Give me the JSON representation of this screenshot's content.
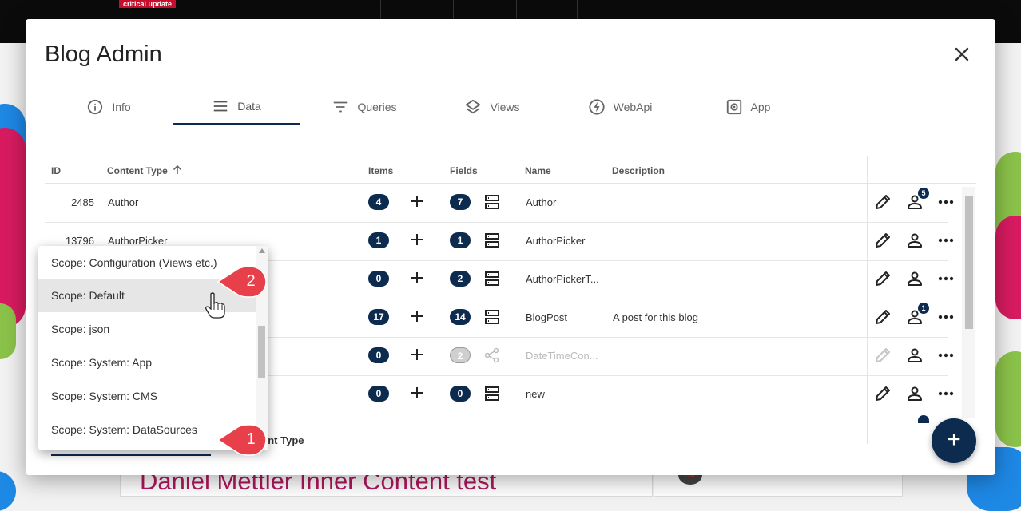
{
  "background": {
    "badge": "critical update",
    "content_title": "Daniel Mettler Inner Content test"
  },
  "dialog": {
    "title": "Blog Admin",
    "close_icon": "close-icon"
  },
  "tabs": [
    {
      "label": "Info",
      "icon": "info-icon"
    },
    {
      "label": "Data",
      "icon": "menu-lines-icon",
      "active": true
    },
    {
      "label": "Queries",
      "icon": "filter-icon"
    },
    {
      "label": "Views",
      "icon": "layers-icon"
    },
    {
      "label": "WebApi",
      "icon": "bolt-icon"
    },
    {
      "label": "App",
      "icon": "settings-box-icon"
    }
  ],
  "table": {
    "headers": {
      "id": "ID",
      "content_type": "Content Type",
      "items": "Items",
      "fields": "Fields",
      "name": "Name",
      "description": "Description"
    },
    "sort_icon": "arrow-up-icon",
    "rows": [
      {
        "id": "2485",
        "content_type": "Author",
        "items": "4",
        "fields": "7",
        "name": "Author",
        "description": "",
        "perm_badge": "5"
      },
      {
        "id": "13796",
        "content_type": "AuthorPicker",
        "items": "1",
        "fields": "1",
        "name": "AuthorPicker",
        "description": ""
      },
      {
        "id": "",
        "content_type": "",
        "items": "0",
        "fields": "2",
        "name": "AuthorPickerT...",
        "description": ""
      },
      {
        "id": "",
        "content_type": "",
        "items": "17",
        "fields": "14",
        "name": "BlogPost",
        "description": "A post for this blog",
        "perm_badge": "1"
      },
      {
        "id": "",
        "content_type": "",
        "items": "0",
        "fields": "2",
        "name": "DateTimeCon...",
        "description": "",
        "disabled": true
      },
      {
        "id": "",
        "content_type": "",
        "items": "0",
        "fields": "0",
        "name": "new",
        "description": ""
      }
    ]
  },
  "scope_dropdown": {
    "options": [
      "Scope: Configuration (Views etc.)",
      "Scope: Default",
      "Scope: json",
      "Scope: System: App",
      "Scope: System: CMS",
      "Scope: System: DataSources"
    ],
    "hovered_index": 1
  },
  "bottom": {
    "label_partial": "ent Type",
    "fab_label": "+"
  },
  "callouts": {
    "first": "1",
    "second": "2"
  },
  "colors": {
    "primary": "#0d2a4f",
    "callout": "#e8404a"
  }
}
